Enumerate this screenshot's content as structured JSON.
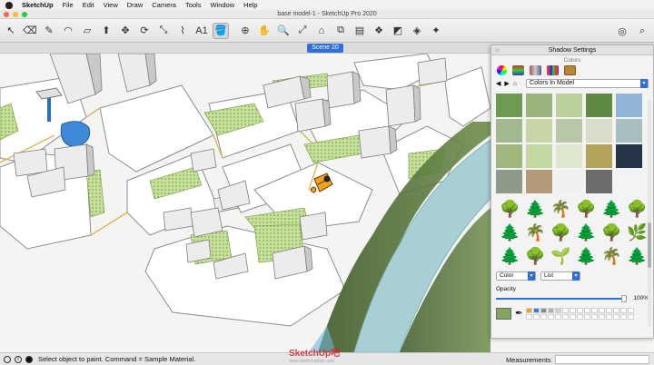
{
  "app": {
    "name": "SketchUp"
  },
  "menu": [
    "File",
    "Edit",
    "View",
    "Draw",
    "Camera",
    "Tools",
    "Window",
    "Help"
  ],
  "window": {
    "title": "base model-1 - SketchUp Pro 2020"
  },
  "toolbar": {
    "tools": [
      {
        "name": "select",
        "glyph": "↖"
      },
      {
        "name": "eraser",
        "glyph": "⌫"
      },
      {
        "name": "line",
        "glyph": "✎"
      },
      {
        "name": "arc",
        "glyph": "◠"
      },
      {
        "name": "rectangle",
        "glyph": "▱"
      },
      {
        "name": "push-pull",
        "glyph": "⬆"
      },
      {
        "name": "move",
        "glyph": "✥"
      },
      {
        "name": "rotate",
        "glyph": "⟳"
      },
      {
        "name": "scale",
        "glyph": "⤡"
      },
      {
        "name": "tape-measure",
        "glyph": "⌇"
      },
      {
        "name": "text",
        "glyph": "A1"
      },
      {
        "name": "paint-bucket",
        "glyph": "🪣"
      },
      {
        "name": "orbit",
        "glyph": "⊕"
      },
      {
        "name": "pan",
        "glyph": "✋"
      },
      {
        "name": "zoom",
        "glyph": "🔍"
      },
      {
        "name": "zoom-extents",
        "glyph": "⤢"
      },
      {
        "name": "warehouse",
        "glyph": "⌂"
      },
      {
        "name": "extensions",
        "glyph": "⧉"
      },
      {
        "name": "layout",
        "glyph": "▤"
      },
      {
        "name": "components",
        "glyph": "❖"
      },
      {
        "name": "styles",
        "glyph": "◩"
      },
      {
        "name": "sandbox",
        "glyph": "◈"
      },
      {
        "name": "walk",
        "glyph": "✦"
      }
    ]
  },
  "scenes": [
    {
      "label": "Scene 20",
      "active": true
    }
  ],
  "panel": {
    "title": "Shadow Settings",
    "section": "Colors",
    "collection": "Colors In Model",
    "swatch_colors": [
      [
        "#6e9a52",
        "#9ab57b",
        "#bcd19a",
        "#5f8a43",
        "#8fb5d9"
      ],
      [
        "#a2b98e",
        "#c8d6a6",
        "#b7c7a8",
        "#d8dcc8",
        "#a9bfbf"
      ],
      [
        "#9fb77c",
        "#c2d7a2",
        "#dfe7d0",
        "#b3a35a",
        "#263447"
      ],
      [
        "#8d9a87",
        "#b39a76",
        "#f0f0ee",
        "#6c6c6c",
        ""
      ]
    ],
    "display_mode": "Color",
    "view_mode": "List",
    "opacity_label": "Opacity",
    "opacity": "100%",
    "opacity_value": 1.0
  },
  "status": {
    "message": "Select object to paint. Command = Sample Material.",
    "measurements_label": "Measurements"
  },
  "watermark": {
    "brand": "SketchUp吧",
    "url": "www.sketchupbar.com"
  },
  "colors": {
    "accent": "#2f6fd6",
    "ground": "#f4f5f2",
    "lawn": "#c6e09b",
    "road_edge": "#d7b85a",
    "river": "#a7cfd4",
    "riverbank": "#4f6b35"
  }
}
